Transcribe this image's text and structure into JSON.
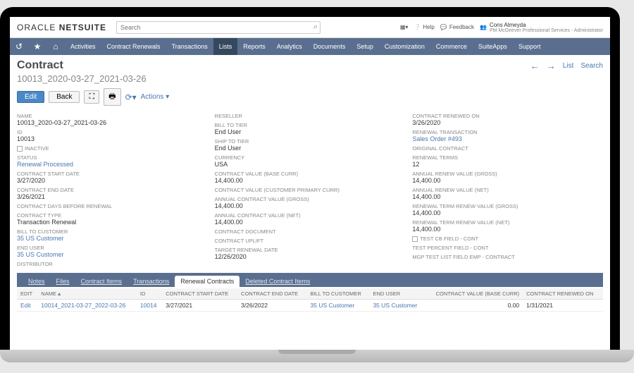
{
  "brand": {
    "part1": "ORACLE",
    "part2": "NETSUITE"
  },
  "search": {
    "placeholder": "Search"
  },
  "top": {
    "help": "Help",
    "feedback": "Feedback",
    "user_name": "Cons Almeyda",
    "user_role": "PM McGeever Professional Services - Administrator"
  },
  "nav": [
    "Activities",
    "Contract Renewals",
    "Transactions",
    "Lists",
    "Reports",
    "Analytics",
    "Documents",
    "Setup",
    "Customization",
    "Commerce",
    "SuiteApps",
    "Support"
  ],
  "nav_active": 3,
  "page": {
    "title": "Contract",
    "record_name": "10013_2020-03-27_2021-03-26",
    "list": "List",
    "search": "Search"
  },
  "buttons": {
    "edit": "Edit",
    "back": "Back",
    "actions": "Actions"
  },
  "col1": [
    {
      "lbl": "NAME",
      "val": "10013_2020-03-27_2021-03-26"
    },
    {
      "lbl": "ID",
      "val": "10013"
    },
    {
      "lbl": "INACTIVE",
      "chk": true
    },
    {
      "lbl": "STATUS",
      "val": "Renewal Processed",
      "link": true
    },
    {
      "lbl": "CONTRACT START DATE",
      "val": "3/27/2020"
    },
    {
      "lbl": "CONTRACT END DATE",
      "val": "3/26/2021"
    },
    {
      "lbl": "CONTRACT DAYS BEFORE RENEWAL",
      "val": ""
    },
    {
      "lbl": "CONTRACT TYPE",
      "val": "Transaction Renewal"
    },
    {
      "lbl": "BILL TO CUSTOMER",
      "val": "35 US Customer",
      "link": true
    },
    {
      "lbl": "END USER",
      "val": "35 US Customer",
      "link": true
    },
    {
      "lbl": "DISTRIBUTOR",
      "val": ""
    }
  ],
  "col2": [
    {
      "lbl": "RESELLER",
      "val": ""
    },
    {
      "lbl": "BILL TO TIER",
      "val": "End User"
    },
    {
      "lbl": "SHIP TO TIER",
      "val": "End User"
    },
    {
      "lbl": "CURRENCY",
      "val": "USA"
    },
    {
      "lbl": "CONTRACT VALUE (BASE CURR)",
      "val": "14,400.00"
    },
    {
      "lbl": "CONTRACT VALUE (CUSTOMER PRIMARY CURR)",
      "val": ""
    },
    {
      "lbl": "ANNUAL CONTRACT VALUE (GROSS)",
      "val": "14,400.00"
    },
    {
      "lbl": "ANNUAL CONTRACT VALUE (NET)",
      "val": "14,400.00"
    },
    {
      "lbl": "CONTRACT DOCUMENT",
      "val": ""
    },
    {
      "lbl": "CONTRACT UPLIFT",
      "val": ""
    },
    {
      "lbl": "TARGET RENEWAL DATE",
      "val": "12/26/2020"
    }
  ],
  "col3": [
    {
      "lbl": "CONTRACT RENEWED ON",
      "val": "3/26/2020"
    },
    {
      "lbl": "RENEWAL TRANSACTION",
      "val": "Sales Order #493",
      "link": true
    },
    {
      "lbl": "ORIGINAL CONTRACT",
      "val": ""
    },
    {
      "lbl": "RENEWAL TERMS",
      "val": "12"
    },
    {
      "lbl": "ANNUAL RENEW VALUE (GROSS)",
      "val": "14,400.00"
    },
    {
      "lbl": "ANNUAL RENEW VALUE (NET)",
      "val": "14,400.00"
    },
    {
      "lbl": "RENEWAL TERM RENEW VALUE (GROSS)",
      "val": "14,400.00"
    },
    {
      "lbl": "RENEWAL TERM RENEW VALUE (NET)",
      "val": "14,400.00"
    },
    {
      "lbl": "TEST CB FIELD - CONT",
      "chk": true
    },
    {
      "lbl": "TEST PERCENT FIELD - CONT",
      "val": ""
    },
    {
      "lbl": "MGP TEST LIST FIELD EMP - CONTRACT",
      "val": ""
    }
  ],
  "subtabs": [
    "Notes",
    "Files",
    "Contract Items",
    "Transactions",
    "Renewal Contracts",
    "Deleted Contract Items"
  ],
  "subtab_active": 4,
  "table": {
    "headers": [
      "EDIT",
      "NAME",
      "ID",
      "CONTRACT START DATE",
      "CONTRACT END DATE",
      "BILL TO CUSTOMER",
      "END USER",
      "CONTRACT VALUE (BASE CURR)",
      "CONTRACT RENEWED ON"
    ],
    "row": {
      "edit": "Edit",
      "name": "10014_2021-03-27_2022-03-26",
      "id": "10014",
      "start": "3/27/2021",
      "end": "3/26/2022",
      "bill": "35 US Customer",
      "enduser": "35 US Customer",
      "value": "0.00",
      "renewed": "1/31/2021"
    }
  }
}
